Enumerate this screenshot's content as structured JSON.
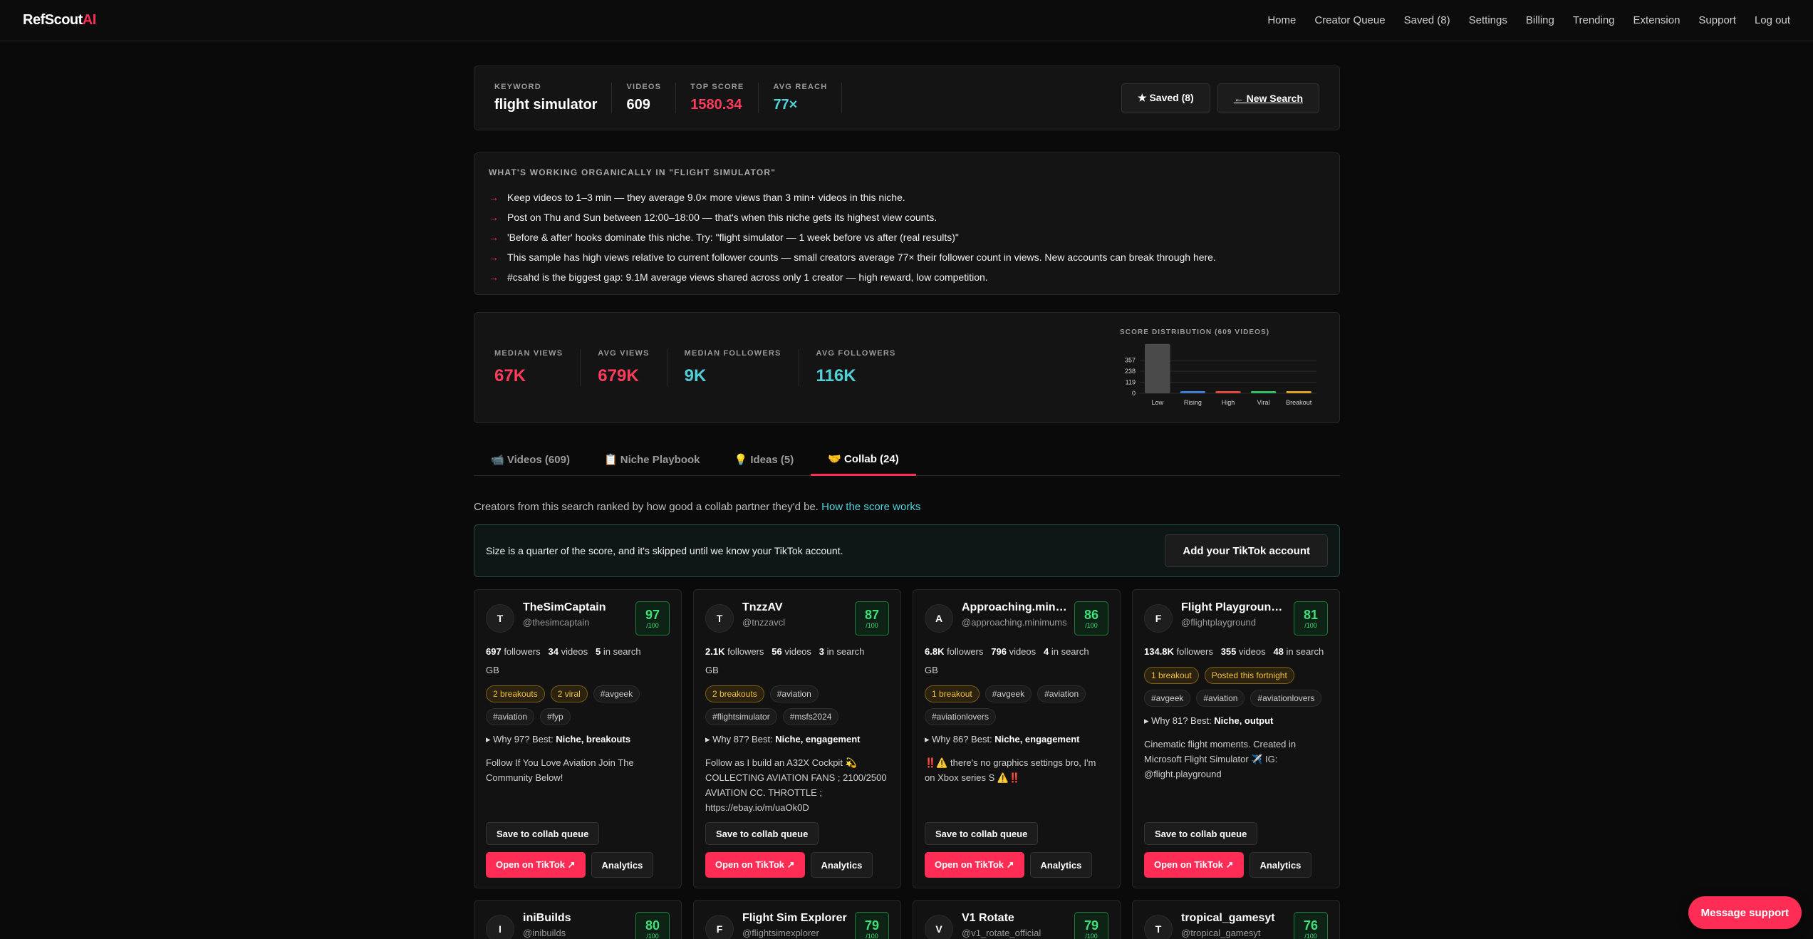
{
  "nav": {
    "logo_main": "RefScout",
    "logo_accent": "AI",
    "links": [
      "Home",
      "Creator Queue",
      "Saved (8)",
      "Settings",
      "Billing",
      "Trending",
      "Extension",
      "Support",
      "Log out"
    ]
  },
  "summary": {
    "keyword_label": "KEYWORD",
    "keyword": "flight simulator",
    "videos_label": "VIDEOS",
    "videos": "609",
    "top_score_label": "TOP SCORE",
    "top_score": "1580.34",
    "avg_reach_label": "AVG REACH",
    "avg_reach": "77×",
    "saved_btn": "★ Saved (8)",
    "new_search_btn": "← New Search"
  },
  "insights": {
    "title": "WHAT'S WORKING ORGANICALLY IN \"FLIGHT SIMULATOR\"",
    "arrow": "→",
    "items": [
      "Keep videos to 1–3 min — they average 9.0× more views than 3 min+ videos in this niche.",
      "Post on Thu and Sun between 12:00–18:00 — that's when this niche gets its highest view counts.",
      "'Before & after' hooks dominate this niche. Try: \"flight simulator — 1 week before vs after (real results)\"",
      "This sample has high views relative to current follower counts — small creators average 77× their follower count in views. New accounts can break through here.",
      "#csahd is the biggest gap: 9.1M average views shared across only 1 creator — high reward, low competition."
    ]
  },
  "metrics": {
    "median_views_label": "MEDIAN VIEWS",
    "median_views": "67K",
    "avg_views_label": "AVG VIEWS",
    "avg_views": "679K",
    "median_followers_label": "MEDIAN FOLLOWERS",
    "median_followers": "9K",
    "avg_followers_label": "AVG FOLLOWERS",
    "avg_followers": "116K"
  },
  "chart_data": {
    "type": "bar",
    "title": "SCORE DISTRIBUTION (609 VIDEOS)",
    "categories": [
      "Low",
      "Rising",
      "High",
      "Viral",
      "Breakout"
    ],
    "values": [
      560,
      20,
      9,
      8,
      12
    ],
    "yticks": [
      "357",
      "238",
      "119",
      "0"
    ],
    "ylim": [
      0,
      476
    ],
    "colors": [
      "#4a4a4a",
      "#3b7bd4",
      "#e0453a",
      "#2fbf5f",
      "#e0a020"
    ],
    "grid": true
  },
  "tabs": [
    "📹 Videos (609)",
    "📋 Niche Playbook",
    "💡 Ideas (5)",
    "🤝 Collab (24)"
  ],
  "intro": {
    "text": "Creators from this search ranked by how good a collab partner they'd be. ",
    "link": "How the score works"
  },
  "banner": {
    "text": "Size is a quarter of the score, and it's skipped until we know your TikTok account.",
    "button": "Add your TikTok account"
  },
  "card_buttons": {
    "save": "Save to collab queue",
    "tiktok": "Open on TikTok ↗",
    "analytics": "Analytics",
    "score_max": "/100"
  },
  "cards": [
    {
      "initial": "T",
      "name": "TheSimCaptain",
      "handle": "@thesimcaptain",
      "score": "97",
      "followers": "697",
      "followers_label": "followers",
      "videos": "34",
      "videos_label": "videos",
      "in_search": "5",
      "in_search_label": "in search",
      "country": "GB",
      "gold_tags": [
        "2 breakouts",
        "2 viral"
      ],
      "tags": [
        "#avgeek",
        "#aviation",
        "#fyp"
      ],
      "why": "▸ Why 97? Best: ",
      "why_best": "Niche, breakouts",
      "desc": "Follow If You Love Aviation Join The Community Below!"
    },
    {
      "initial": "T",
      "name": "TnzzAV",
      "handle": "@tnzzavcl",
      "score": "87",
      "followers": "2.1K",
      "followers_label": "followers",
      "videos": "56",
      "videos_label": "videos",
      "in_search": "3",
      "in_search_label": "in search",
      "country": "GB",
      "gold_tags": [
        "2 breakouts"
      ],
      "tags": [
        "#aviation",
        "#flightsimulator",
        "#msfs2024"
      ],
      "why": "▸ Why 87? Best: ",
      "why_best": "Niche, engagement",
      "desc": "Follow as I build an A32X Cockpit 💫 COLLECTING AVIATION FANS ; 2100/2500 AVIATION CC. THROTTLE ; https://ebay.io/m/uaOk0D"
    },
    {
      "initial": "A",
      "name": "Approaching.minimums",
      "handle": "@approaching.minimums",
      "score": "86",
      "followers": "6.8K",
      "followers_label": "followers",
      "videos": "796",
      "videos_label": "videos",
      "in_search": "4",
      "in_search_label": "in search",
      "country": "GB",
      "gold_tags": [
        "1 breakout"
      ],
      "tags": [
        "#avgeek",
        "#aviation",
        "#aviationlovers"
      ],
      "why": "▸ Why 86? Best: ",
      "why_best": "Niche, engagement",
      "desc": "‼️⚠️ there's no graphics settings bro, I'm on Xbox series S ⚠️‼️"
    },
    {
      "initial": "F",
      "name": "Flight Playground Studios",
      "handle": "@flightplayground",
      "score": "81",
      "followers": "134.8K",
      "followers_label": "followers",
      "videos": "355",
      "videos_label": "videos",
      "in_search": "48",
      "in_search_label": "in search",
      "country": "",
      "gold_tags": [
        "1 breakout",
        "Posted this fortnight"
      ],
      "tags": [
        "#avgeek",
        "#aviation",
        "#aviationlovers"
      ],
      "why": "▸ Why 81? Best: ",
      "why_best": "Niche, output",
      "desc": "Cinematic flight moments. Created in Microsoft Flight Simulator ✈️ IG: @flight.playground"
    }
  ],
  "cards_row2": [
    {
      "initial": "I",
      "name": "iniBuilds",
      "handle": "@inibuilds",
      "score": "80"
    },
    {
      "initial": "F",
      "name": "Flight Sim Explorer",
      "handle": "@flightsimexplorer",
      "score": "79"
    },
    {
      "initial": "V",
      "name": "V1 Rotate",
      "handle": "@v1_rotate_official",
      "score": "79"
    },
    {
      "initial": "T",
      "name": "tropical_gamesyt",
      "handle": "@tropical_gamesyt",
      "score": "76"
    }
  ],
  "support_btn": "Message support"
}
